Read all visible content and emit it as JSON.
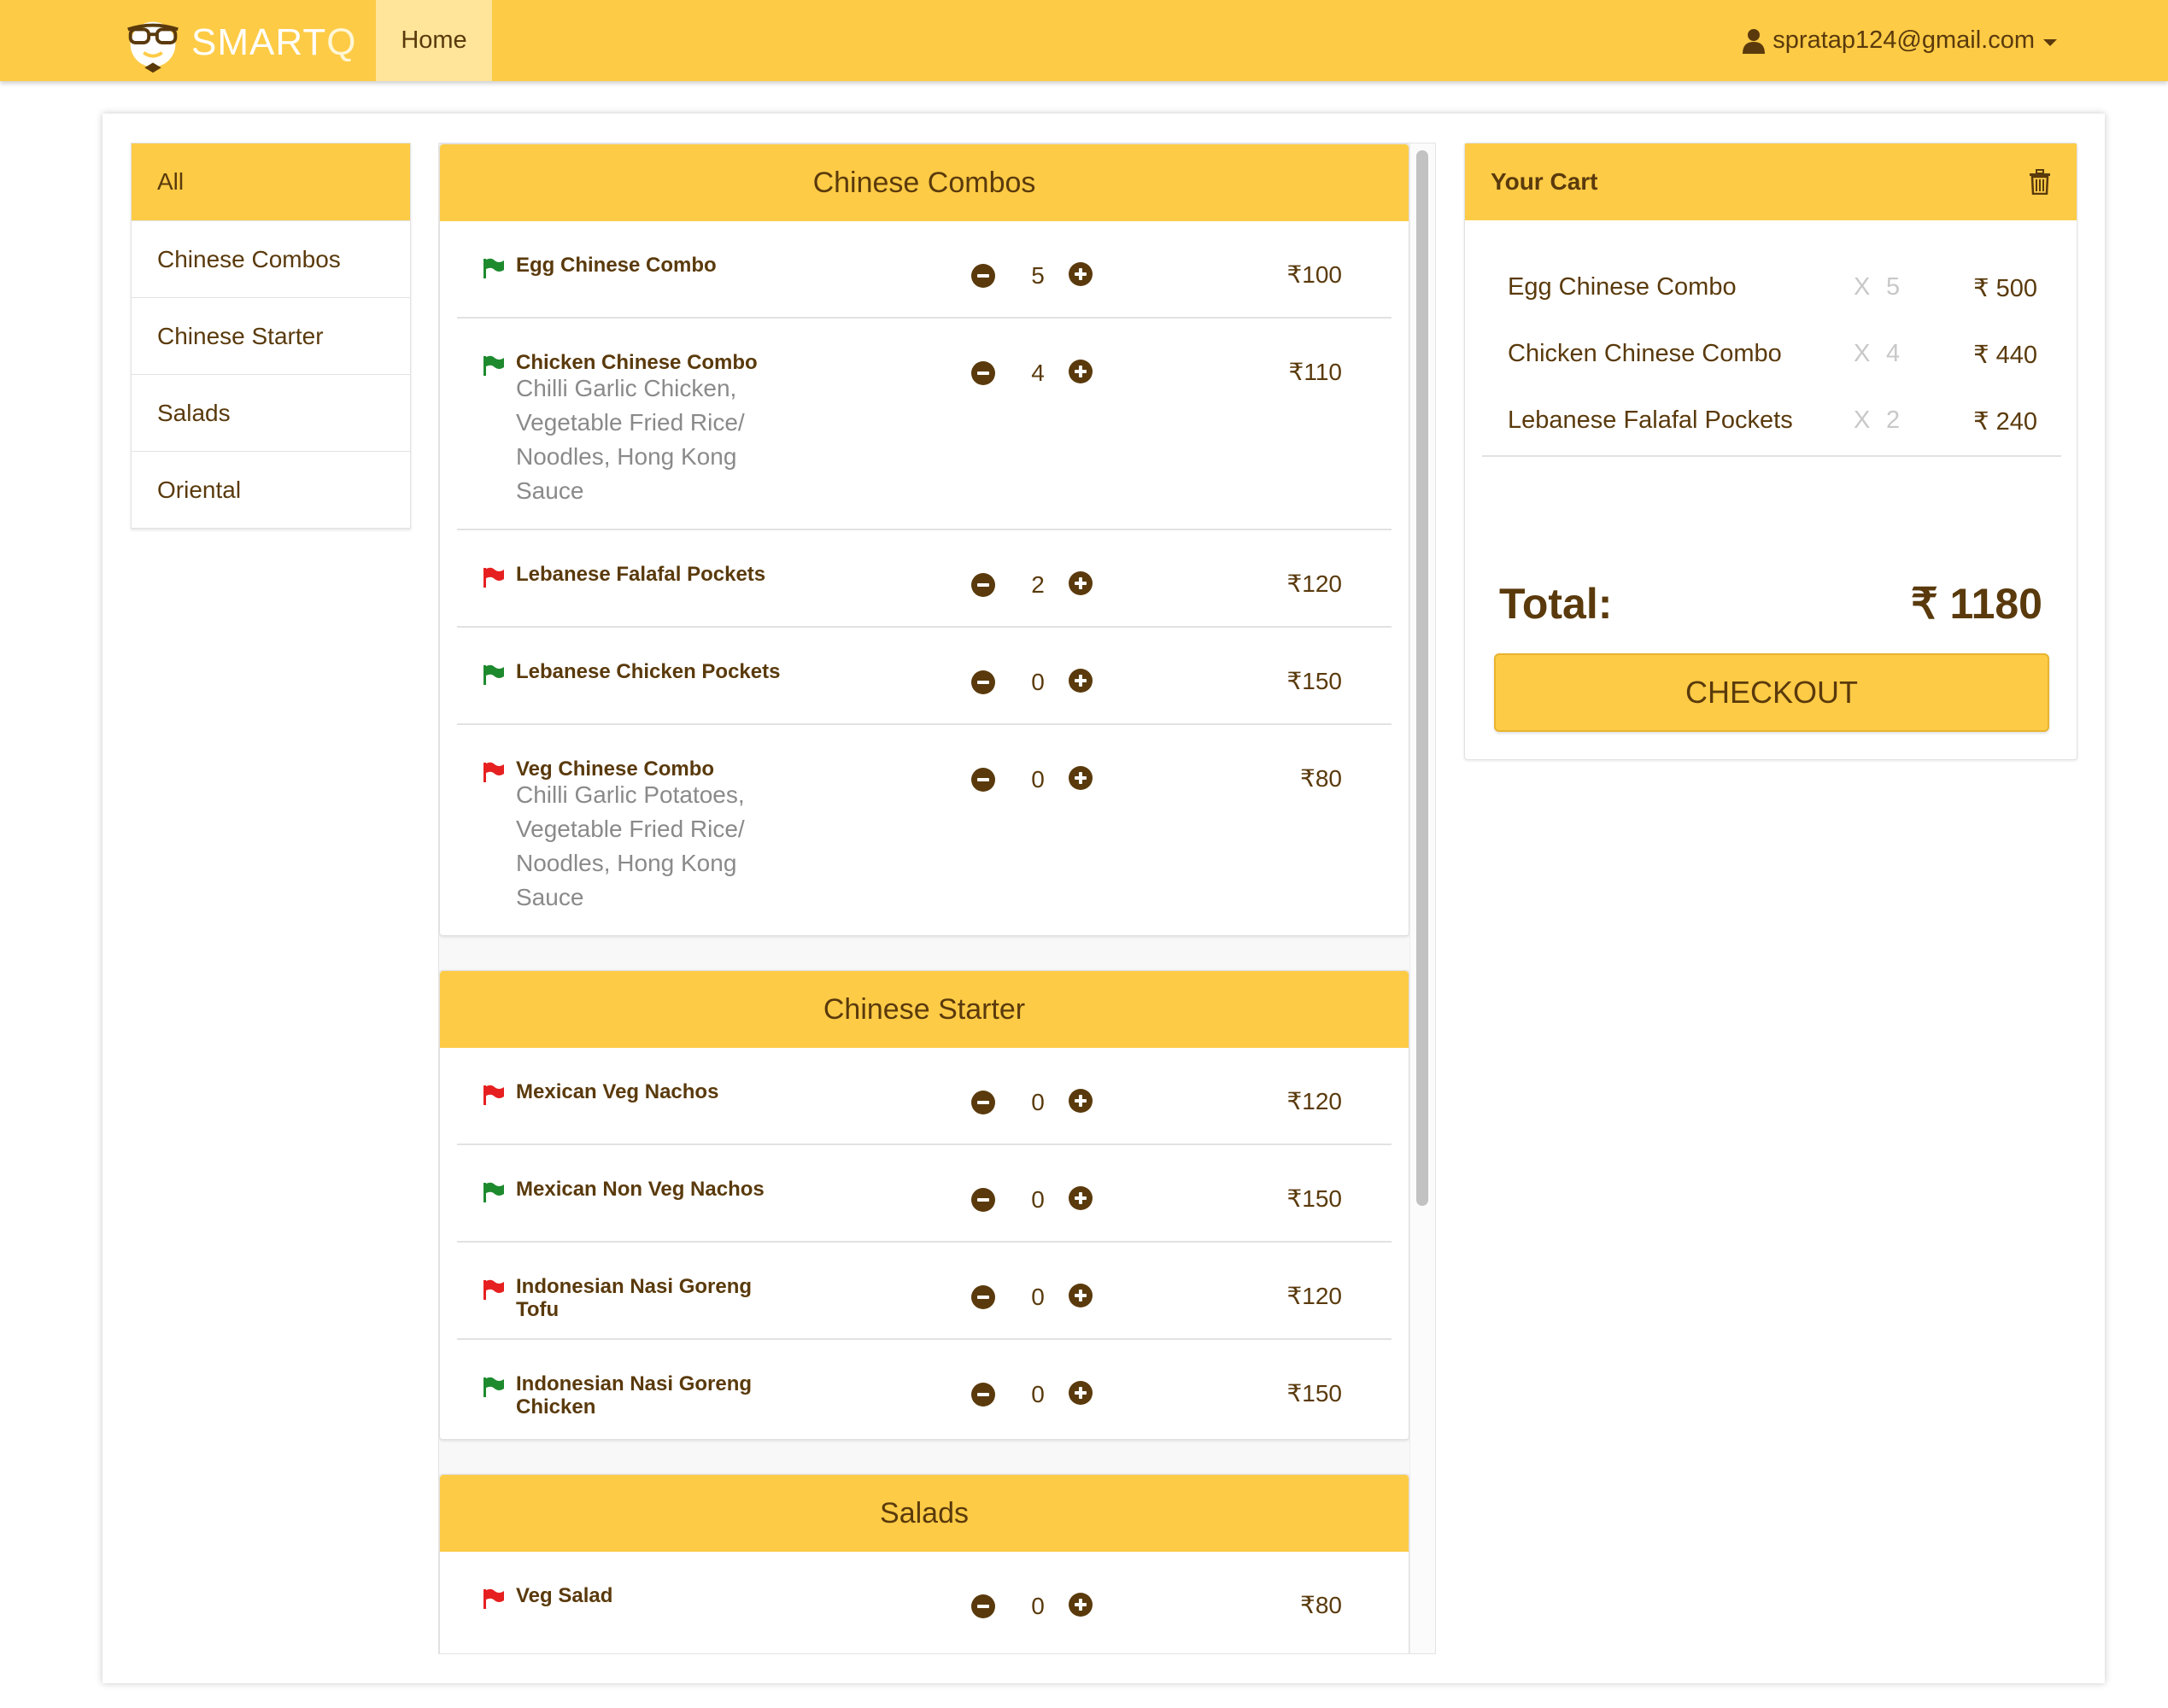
{
  "brand": {
    "name_main": "SMART",
    "name_accent": "Q",
    "logo_icon": "glasses-face-logo"
  },
  "nav": {
    "home": "Home",
    "user_email": "spratap124@gmail.com",
    "user_icon": "user-icon"
  },
  "colors": {
    "accent": "#fdcb46",
    "text": "#5a3a0c",
    "veg": "#1e8a2e",
    "nonveg": "#e62020"
  },
  "categories": [
    "All",
    "Chinese Combos",
    "Chinese Starter",
    "Salads",
    "Oriental"
  ],
  "active_category": "All",
  "sections": [
    {
      "title": "Chinese Combos",
      "items": [
        {
          "name": "Egg Chinese Combo",
          "desc": "",
          "qty": "5",
          "price": "₹100",
          "flag": "green"
        },
        {
          "name": "Chicken Chinese Combo",
          "desc": "Chilli Garlic Chicken, Vegetable Fried Rice/ Noodles, Hong Kong Sauce",
          "qty": "4",
          "price": "₹110",
          "flag": "green"
        },
        {
          "name": "Lebanese Falafal Pockets",
          "desc": "",
          "qty": "2",
          "price": "₹120",
          "flag": "red"
        },
        {
          "name": "Lebanese Chicken Pockets",
          "desc": "",
          "qty": "0",
          "price": "₹150",
          "flag": "green"
        },
        {
          "name": "Veg Chinese Combo",
          "desc": "Chilli Garlic Potatoes, Vegetable Fried Rice/ Noodles, Hong Kong Sauce",
          "qty": "0",
          "price": "₹80",
          "flag": "red"
        }
      ]
    },
    {
      "title": "Chinese Starter",
      "items": [
        {
          "name": "Mexican Veg Nachos",
          "desc": "",
          "qty": "0",
          "price": "₹120",
          "flag": "red"
        },
        {
          "name": "Mexican Non Veg Nachos",
          "desc": "",
          "qty": "0",
          "price": "₹150",
          "flag": "green"
        },
        {
          "name": "Indonesian Nasi Goreng Tofu",
          "desc": "",
          "qty": "0",
          "price": "₹120",
          "flag": "red"
        },
        {
          "name": "Indonesian Nasi Goreng Chicken",
          "desc": "",
          "qty": "0",
          "price": "₹150",
          "flag": "green"
        }
      ]
    },
    {
      "title": "Salads",
      "items": [
        {
          "name": "Veg Salad",
          "desc": "",
          "qty": "0",
          "price": "₹80",
          "flag": "red"
        }
      ]
    }
  ],
  "cart": {
    "title": "Your Cart",
    "items": [
      {
        "name": "Egg Chinese Combo",
        "x": "X",
        "qty": "5",
        "price": "₹ 500"
      },
      {
        "name": "Chicken Chinese Combo",
        "x": "X",
        "qty": "4",
        "price": "₹ 440"
      },
      {
        "name": "Lebanese Falafal Pockets",
        "x": "X",
        "qty": "2",
        "price": "₹ 240"
      }
    ],
    "total_label": "Total:",
    "total_value": "₹ 1180",
    "checkout_label": "CHECKOUT"
  }
}
